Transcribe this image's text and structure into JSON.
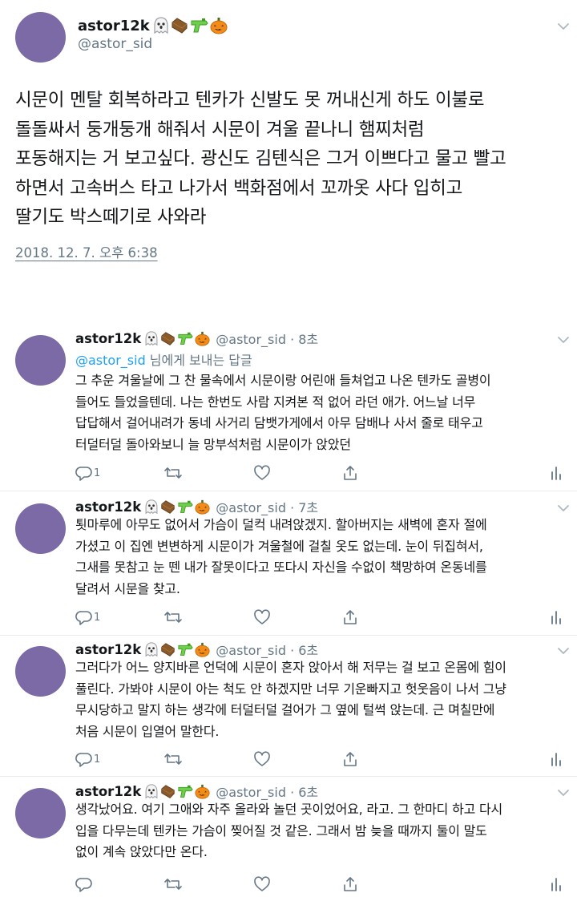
{
  "main_tweet": {
    "display_name": "astor12k",
    "handle": "@astor_sid",
    "text": "시문이 멘탈 회복하라고 텐카가 신발도 못 꺼내신게 하도 이불로\n돌돌싸서 둥개둥개 해줘서 시문이 겨울 끝나니 햄찌처럼\n포동해지는 거 보고싶다. 광신도 김텐식은 그거 이쁘다고 물고 빨고\n하면서 고속버스 타고 나가서 백화점에서 꼬까옷 사다 입히고\n딸기도 박스떼기로 사와라",
    "timestamp": "2018. 12. 7. 오후 6:38"
  },
  "name_emojis": [
    "ghost",
    "coffin",
    "water-pistol",
    "jack-o-lantern"
  ],
  "replies": [
    {
      "display_name": "astor12k",
      "handle_time": "@astor_sid · 8초",
      "reply_to_mention": "@astor_sid",
      "reply_to_suffix": " 님에게 보내는 답글",
      "text": "그 추운 겨울날에 그 찬 물속에서 시문이랑 어린애 들쳐업고 나온 텐카도 골병이\n들어도 들었을텐데. 나는 한번도 사람 지켜본 적 없어 라던 애가. 어느날 너무\n답답해서 걸어내려가 동네 사거리 담뱃가게에서 아무 담배나 사서 줄로 태우고\n터덜터덜 돌아와보니 늘 망부석처럼 시문이가 앉았던",
      "reply_count": "1"
    },
    {
      "display_name": "astor12k",
      "handle_time": "@astor_sid · 7초",
      "text": "툇마루에 아무도 없어서 가슴이 덜컥 내려앉겠지. 할아버지는 새벽에 혼자 절에\n가셨고 이 집엔 변변하게 시문이가 겨울철에 걸칠 옷도 없는데. 눈이 뒤집혀서,\n그새를 못참고 눈 뗀 내가 잘못이다고 또다시 자신을 수없이 책망하여 온동네를\n달려서 시문을 찾고.",
      "reply_count": "1"
    },
    {
      "display_name": "astor12k",
      "handle_time": "@astor_sid · 6초",
      "text": "그러다가 어느 양지바른 언덕에 시문이 혼자 앉아서 해 저무는 걸 보고 온몸에 힘이\n풀린다. 가봐야 시문이 아는 척도 안 하겠지만 너무 기운빠지고 헛웃음이 나서 그냥\n무시당하고 말지 하는 생각에 터덜터덜 걸어가 그 옆에 털썩 앉는데. 근 며칠만에\n처음 시문이 입열어 말한다.",
      "reply_count": "1"
    },
    {
      "display_name": "astor12k",
      "handle_time": "@astor_sid · 6초",
      "text": "생각났어요. 여기 그애와 자주 올라와 놀던 곳이었어요, 라고. 그 한마디 하고 다시\n입을 다무는데 텐카는 가슴이 찢어질 것 같은. 그래서 밤 늦을 때까지 둘이 말도\n없이 계속 앉았다만 온다.",
      "reply_count": ""
    }
  ],
  "icons": {
    "reply": "reply-icon",
    "retweet": "retweet-icon",
    "like": "heart-icon",
    "share": "share-icon",
    "analytics": "analytics-icon",
    "more": "chevron-down-icon"
  },
  "colors": {
    "avatar": "#7b6aa6",
    "link": "#1da1f2",
    "secondary_text": "#657786",
    "primary_text": "#14171a"
  }
}
